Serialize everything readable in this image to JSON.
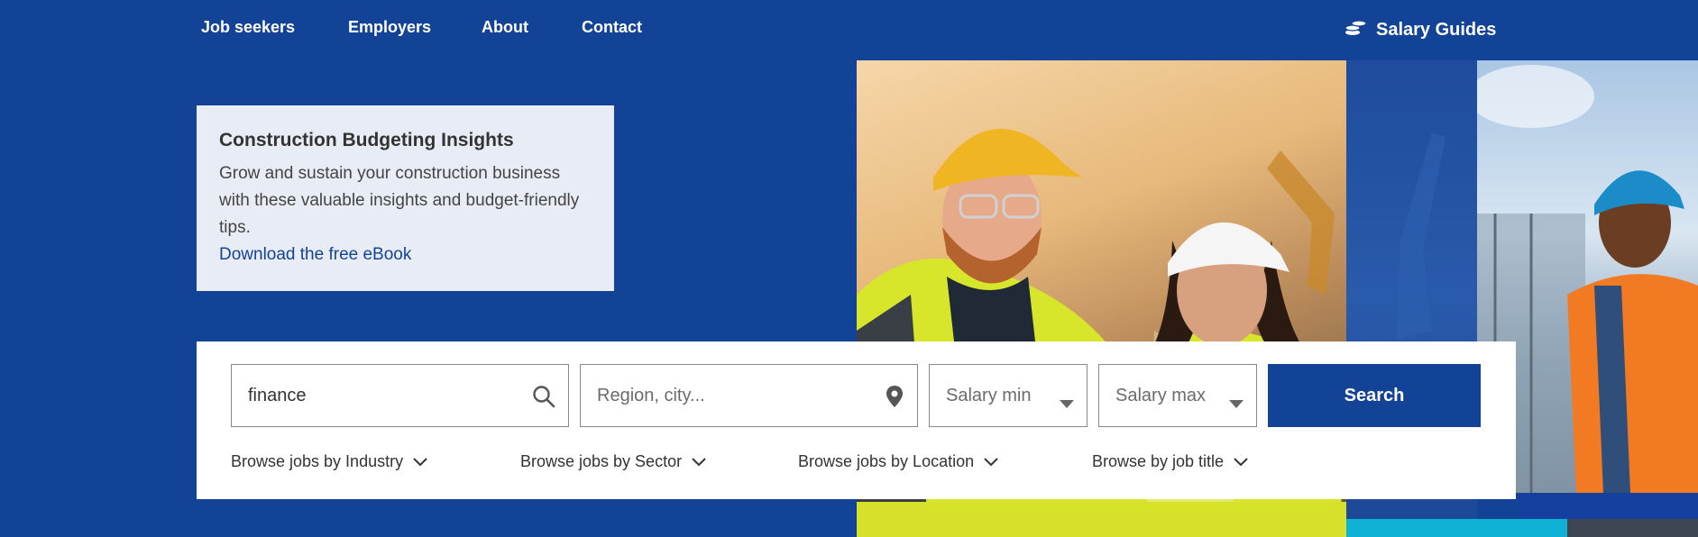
{
  "nav": {
    "items": [
      {
        "label": "Job seekers"
      },
      {
        "label": "Employers"
      },
      {
        "label": "About"
      },
      {
        "label": "Contact"
      }
    ],
    "salary_guides": "Salary Guides"
  },
  "promo": {
    "title": "Construction Budgeting Insights",
    "body": "Grow and sustain your construction business with these valuable insights and budget-friendly tips.",
    "link": "Download the free eBook"
  },
  "search": {
    "keyword_value": "finance",
    "location_placeholder": "Region, city...",
    "salary_min": "Salary min",
    "salary_max": "Salary max",
    "button": "Search"
  },
  "browse": [
    {
      "label": "Browse jobs by Industry"
    },
    {
      "label": "Browse jobs by Sector"
    },
    {
      "label": "Browse jobs by Location"
    },
    {
      "label": "Browse by job title"
    }
  ],
  "colors": {
    "brand_blue": "#134396",
    "card_bg": "#e8ecf4",
    "accent_teal": "#0fb1d5"
  },
  "icons": [
    "coins-icon",
    "search-icon",
    "location-pin-icon",
    "caret-down-icon",
    "chevron-down-icon"
  ]
}
